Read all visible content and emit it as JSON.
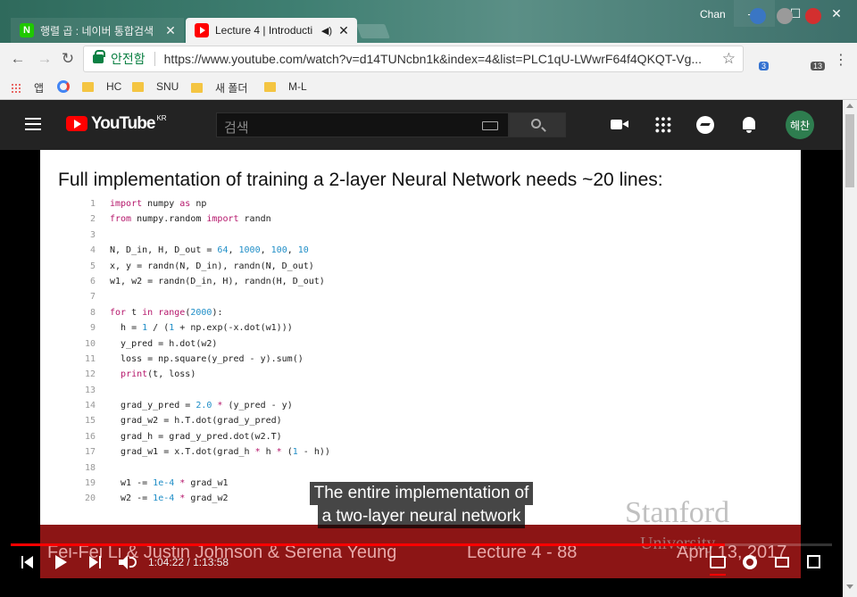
{
  "window": {
    "profile_name": "Chan",
    "controls": {
      "minimize": "—",
      "maximize": "☐",
      "close": "✕"
    }
  },
  "tabs": [
    {
      "title": "행렬 곱 : 네이버 통합검색",
      "favicon": "naver-icon",
      "active": false,
      "close": "✕"
    },
    {
      "title": "Lecture 4 | Introducti",
      "favicon": "youtube-icon",
      "active": true,
      "audio": "◀)",
      "close": "✕"
    }
  ],
  "toolbar": {
    "back": "←",
    "forward": "→",
    "reload": "↻",
    "secure_label": "안전함",
    "url": "https://www.youtube.com/watch?v=d14TUNcbn1k&index=4&list=PLC1qU-LWwrF64f4QKQT-Vg...",
    "star": "☆",
    "extensions": [
      {
        "icon": "extension-blue-icon",
        "badge": "3"
      },
      {
        "icon": "extension-globe-icon",
        "badge": ""
      },
      {
        "icon": "extension-red-icon",
        "badge": "13"
      }
    ],
    "menu": "⋮"
  },
  "bookmarks": [
    {
      "label": "앱",
      "icon": "apps-grid-icon"
    },
    {
      "label": "",
      "icon": "google-icon"
    },
    {
      "label": "HC",
      "icon": "folder-icon"
    },
    {
      "label": "SNU",
      "icon": "folder-icon"
    },
    {
      "label": "새 폴더",
      "icon": "folder-icon"
    },
    {
      "label": "M-L",
      "icon": "folder-icon"
    }
  ],
  "youtube": {
    "logo_text": "YouTube",
    "region": "KR",
    "search_placeholder": "검색",
    "avatar_text": "해찬"
  },
  "slide": {
    "title": "Full implementation of training a 2-layer Neural Network needs ~20 lines:",
    "code": [
      {
        "n": "1",
        "html": "<span class=\"kw\">import</span> numpy <span class=\"kw\">as</span> np"
      },
      {
        "n": "2",
        "html": "<span class=\"kw\">from</span> numpy.random <span class=\"kw\">import</span> randn"
      },
      {
        "n": "3",
        "html": ""
      },
      {
        "n": "4",
        "html": "N, D_in, H, D_out = <span class=\"num\">64</span>, <span class=\"num\">1000</span>, <span class=\"num\">100</span>, <span class=\"num\">10</span>"
      },
      {
        "n": "5",
        "html": "x, y = randn(N, D_in), randn(N, D_out)"
      },
      {
        "n": "6",
        "html": "w1, w2 = randn(D_in, H), randn(H, D_out)"
      },
      {
        "n": "7",
        "html": ""
      },
      {
        "n": "8",
        "html": "<span class=\"kw\">for</span> t <span class=\"kw\">in</span> <span class=\"fn\">range</span>(<span class=\"num\">2000</span>):"
      },
      {
        "n": "9",
        "html": "  h = <span class=\"num\">1</span> / (<span class=\"num\">1</span> + np.exp(-x.dot(w1)))"
      },
      {
        "n": "10",
        "html": "  y_pred = h.dot(w2)"
      },
      {
        "n": "11",
        "html": "  loss = np.square(y_pred - y).sum()"
      },
      {
        "n": "12",
        "html": "  <span class=\"fn\">print</span>(t, loss)"
      },
      {
        "n": "13",
        "html": ""
      },
      {
        "n": "14",
        "html": "  grad_y_pred = <span class=\"num\">2.0</span> <span class=\"kw\">*</span> (y_pred - y)"
      },
      {
        "n": "15",
        "html": "  grad_w2 = h.T.dot(grad_y_pred)"
      },
      {
        "n": "16",
        "html": "  grad_h = grad_y_pred.dot(w2.T)"
      },
      {
        "n": "17",
        "html": "  grad_w1 = x.T.dot(grad_h <span class=\"kw\">*</span> h <span class=\"kw\">*</span> (<span class=\"num\">1</span> - h))"
      },
      {
        "n": "18",
        "html": ""
      },
      {
        "n": "19",
        "html": "  w1 -= <span class=\"num\">1e-4</span> <span class=\"kw\">*</span> grad_w1"
      },
      {
        "n": "20",
        "html": "  w2 -= <span class=\"num\">1e-4</span> <span class=\"kw\">*</span> grad_w2"
      }
    ],
    "footer_authors": "Fei-Fei Li & Justin Johnson & Serena Yeung",
    "footer_lecture": "Lecture 4 - 88",
    "footer_date": "April 13, 2017",
    "logo_main": "Stanford",
    "logo_sub": "University"
  },
  "caption": [
    "The entire implementation of",
    "a two-layer neural network"
  ],
  "player": {
    "time_current": "1:04:22",
    "time_total": "1:13:58",
    "progress": 0.87
  },
  "colors": {
    "accent": "#ff0000",
    "secure": "#0b8043",
    "footer": "#8c1515"
  }
}
